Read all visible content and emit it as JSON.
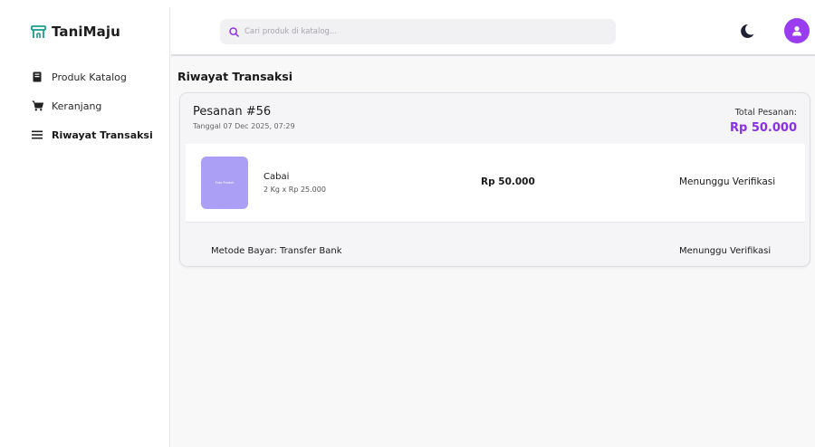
{
  "brand": {
    "name": "TaniMaju",
    "icon": "storefront-icon",
    "accent": "#1a9e8f"
  },
  "sidebar": {
    "items": [
      {
        "label": "Produk Katalog",
        "icon": "book-icon",
        "active": false
      },
      {
        "label": "Keranjang",
        "icon": "cart-icon",
        "active": false
      },
      {
        "label": "Riwayat Transaksi",
        "icon": "list-icon",
        "active": true
      }
    ]
  },
  "header": {
    "search_placeholder": "Cari produk di katalog...",
    "theme_icon": "moon-icon",
    "avatar_icon": "user-icon",
    "accent": "#9a3df0"
  },
  "main": {
    "title": "Riwayat Transaksi",
    "order": {
      "id_label": "Pesanan #56",
      "date_label": "Tanggal 07 Dec 2025, 07:29",
      "total_label": "Total Pesanan:",
      "total_amount": "Rp 50.000",
      "items": [
        {
          "thumb_text": "Foto Produk",
          "name": "Cabai",
          "qty": "2 Kg x Rp 25.000",
          "price": "Rp 50.000",
          "status": "Menunggu Verifikasi"
        }
      ],
      "payment_method": "Metode Bayar: Transfer Bank",
      "payment_status": "Menunggu Verifikasi"
    }
  }
}
